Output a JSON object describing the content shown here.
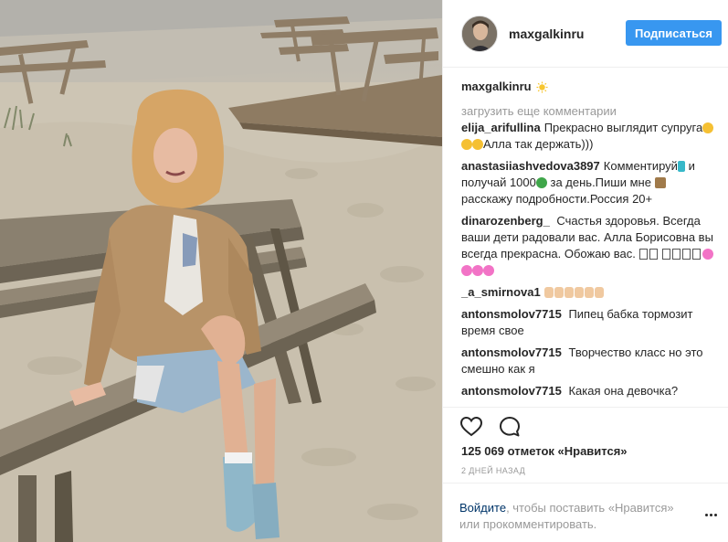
{
  "post": {
    "username": "maxgalkinru",
    "follow_label": "Подписаться",
    "caption_author": "maxgalkinru",
    "load_more": "загрузить еще комментарии",
    "comments": [
      {
        "author": "elija_arifullina",
        "text_a": "Прекрасно выглядит супруга",
        "text_b": "Алла так держать)))"
      },
      {
        "author": "anastasiiashvedova3897",
        "text_a": "Комментируй",
        "text_b": "и получай 1000",
        "text_c": "за день.Пиши мне",
        "text_d": "расскажу подробности.Россия 20+"
      },
      {
        "author": "dinarozenberg_",
        "text_a": "Счастья здоровья. Всегда ваши дети радовали вас. Алла Борисовна вы всегда прекрасна. Обожаю вас."
      },
      {
        "author": "_a_smirnova1",
        "text_a": ""
      },
      {
        "author": "antonsmolov7715",
        "text_a": "Пипец бабка тормозит время свое"
      },
      {
        "author": "antonsmolov7715",
        "text_a": "Творчество класс но это смешно как я"
      },
      {
        "author": "antonsmolov7715",
        "text_a": "Какая она девочка?"
      }
    ],
    "likes": "125 069 отметок «Нравится»",
    "timestamp": "2 ДНЕЙ НАЗАД",
    "login_link": "Войдите",
    "login_text": ", чтобы поставить «Нравится» или прокомментировать."
  },
  "icons": {
    "like": "heart-icon",
    "comment": "comment-bubble-icon",
    "more": "more-dots-icon",
    "caption_emoji": "sun-emoji-icon"
  },
  "colors": {
    "accent": "#3897f0",
    "link": "#003569",
    "muted": "#999999",
    "text": "#262626"
  }
}
